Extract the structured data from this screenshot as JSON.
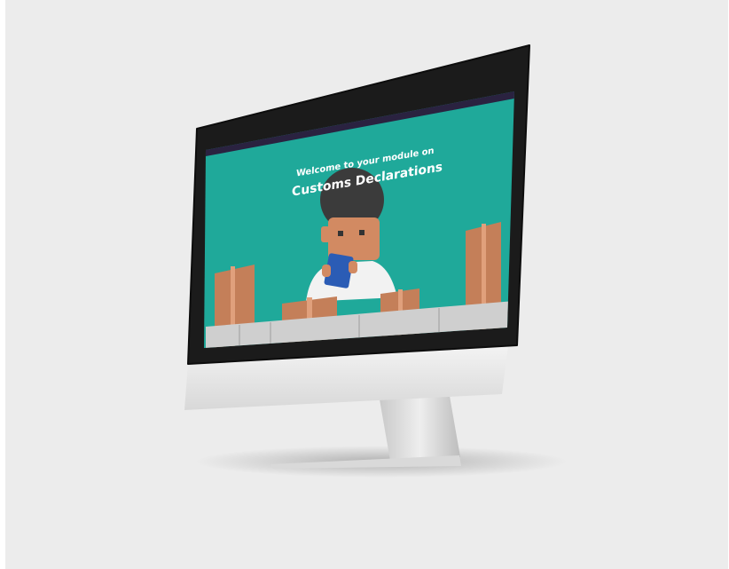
{
  "screen": {
    "welcome_line": "Welcome to your module on",
    "course_title": "Customs Declarations",
    "background_color": "#1fa99a"
  },
  "toolbar": {
    "icons": [
      "globe-icon",
      "help-icon",
      "search-icon",
      "menu-icon",
      "progress-bar"
    ],
    "progress_color": "#e53935"
  }
}
